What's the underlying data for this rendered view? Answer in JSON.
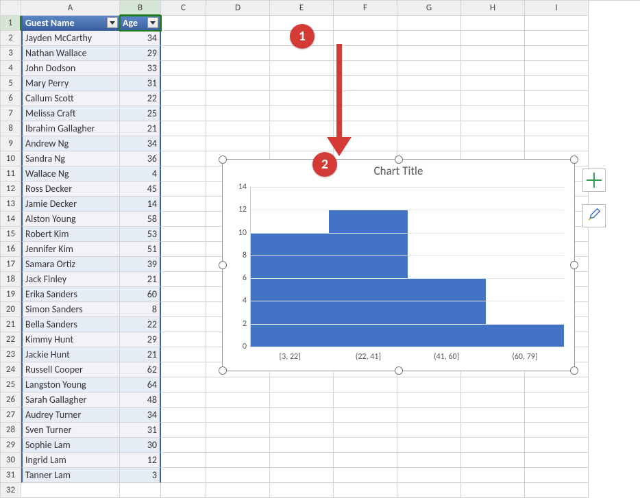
{
  "columns": [
    "A",
    "B",
    "C",
    "D",
    "E",
    "F",
    "G",
    "H",
    "I"
  ],
  "rows_shown": 32,
  "table": {
    "headers": {
      "name": "Guest Name",
      "age": "Age"
    },
    "data": [
      {
        "name": "Jayden McCarthy",
        "age": 34
      },
      {
        "name": "Nathan Wallace",
        "age": 29
      },
      {
        "name": "John Dodson",
        "age": 33
      },
      {
        "name": "Mary Perry",
        "age": 31
      },
      {
        "name": "Callum Scott",
        "age": 22
      },
      {
        "name": "Melissa Craft",
        "age": 25
      },
      {
        "name": "Ibrahim Gallagher",
        "age": 21
      },
      {
        "name": "Andrew Ng",
        "age": 34
      },
      {
        "name": "Sandra Ng",
        "age": 36
      },
      {
        "name": "Wallace Ng",
        "age": 4
      },
      {
        "name": "Ross Decker",
        "age": 45
      },
      {
        "name": "Jamie Decker",
        "age": 14
      },
      {
        "name": "Alston Young",
        "age": 58
      },
      {
        "name": "Robert Kim",
        "age": 53
      },
      {
        "name": "Jennifer Kim",
        "age": 51
      },
      {
        "name": "Samara Ortiz",
        "age": 39
      },
      {
        "name": "Jack Finley",
        "age": 21
      },
      {
        "name": "Erika Sanders",
        "age": 60
      },
      {
        "name": "Simon Sanders",
        "age": 8
      },
      {
        "name": "Bella Sanders",
        "age": 22
      },
      {
        "name": "Kimmy Hunt",
        "age": 29
      },
      {
        "name": "Jackie Hunt",
        "age": 21
      },
      {
        "name": "Russell Cooper",
        "age": 62
      },
      {
        "name": "Langston Young",
        "age": 64
      },
      {
        "name": "Sarah Gallagher",
        "age": 48
      },
      {
        "name": "Audrey Turner",
        "age": 34
      },
      {
        "name": "Sven Turner",
        "age": 31
      },
      {
        "name": "Sophie Lam",
        "age": 30
      },
      {
        "name": "Ingrid Lam",
        "age": 12
      },
      {
        "name": "Tanner Lam",
        "age": 3
      }
    ]
  },
  "chart_data": {
    "type": "bar",
    "title": "Chart Title",
    "categories": [
      "[3, 22]",
      "(22, 41]",
      "(41, 60]",
      "(60, 79]"
    ],
    "values": [
      10,
      12,
      6,
      2
    ],
    "ylim": [
      0,
      14
    ],
    "yticks": [
      0,
      2,
      4,
      6,
      8,
      10,
      12,
      14
    ],
    "bar_color": "#4472c4"
  },
  "annotations": {
    "badge1": "1",
    "badge2": "2"
  }
}
